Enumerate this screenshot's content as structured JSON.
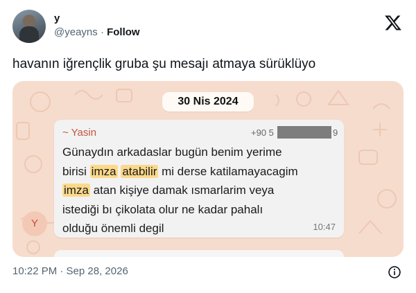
{
  "author": {
    "name": "y",
    "handle": "@yeayns",
    "separator": "·",
    "follow_label": "Follow",
    "avatar_icon": "profile-photo"
  },
  "platform_icon": "x-logo-icon",
  "tweet": {
    "text": "havanın iğrençlik gruba şu mesajı atmaya sürüklüyo",
    "timestamp": "10:22 PM · Sep 28, 2026",
    "info_icon": "info-icon"
  },
  "screenshot": {
    "date_chip": "30 Nis 2024",
    "sender_initial": "Y",
    "sender_name": "~ Yasin",
    "phone_prefix": "+90 5",
    "phone_suffix": "9",
    "message_lines": [
      [
        "Günaydın arkadaslar bugün benim yerime"
      ],
      [
        "birisi ",
        "imza",
        " ",
        "atabilir",
        " mi derse katilamayacagim"
      ],
      [
        "imza",
        " atan kişiye damak ısmarlarim veya"
      ],
      [
        "istediği bı çikolata olur ne kadar pahalı"
      ],
      [
        "olduğu önemli degil"
      ]
    ],
    "highlighted_words": [
      "imza",
      "atabilir",
      "imza"
    ],
    "time": "10:47",
    "colors": {
      "background": "#f6dccd",
      "bubble": "#f2f2f2",
      "highlight": "#fcd98a",
      "sender_name": "#c0563b"
    }
  }
}
